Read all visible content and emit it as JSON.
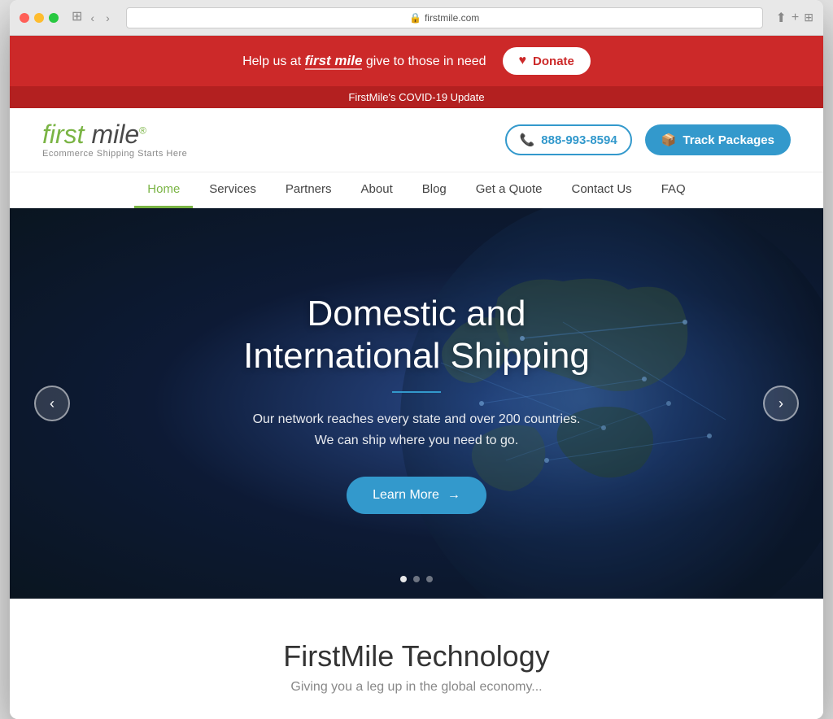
{
  "browser": {
    "url": "firstmile.com",
    "tab_label": "firstmile.com",
    "back_icon": "◀",
    "forward_icon": "▶"
  },
  "donation_banner": {
    "text_prefix": "Help us at ",
    "logo_text": "first mile",
    "text_suffix": " give to those in need",
    "donate_label": "Donate",
    "heart_icon": "♥"
  },
  "covid_banner": {
    "text": "FirstMile's COVID-19 Update"
  },
  "header": {
    "logo_first": "first",
    "logo_mile": " mile",
    "logo_tagline": "Ecommerce Shipping Starts Here",
    "phone": "888-993-8594",
    "phone_icon": "📞",
    "track_label": "Track Packages",
    "track_icon": "📦"
  },
  "nav": {
    "items": [
      {
        "label": "Home",
        "active": true
      },
      {
        "label": "Services",
        "active": false
      },
      {
        "label": "Partners",
        "active": false
      },
      {
        "label": "About",
        "active": false
      },
      {
        "label": "Blog",
        "active": false
      },
      {
        "label": "Get a Quote",
        "active": false
      },
      {
        "label": "Contact Us",
        "active": false
      },
      {
        "label": "FAQ",
        "active": false
      }
    ]
  },
  "hero": {
    "title": "Domestic and\nInternational Shipping",
    "divider": "",
    "subtitle_line1": "Our network reaches every state and over 200 countries.",
    "subtitle_line2": "We can ship where you need to go.",
    "cta_label": "Learn More",
    "cta_arrow": "→",
    "prev_arrow": "‹",
    "next_arrow": "›",
    "dots": [
      {
        "active": true
      },
      {
        "active": false
      },
      {
        "active": false
      }
    ]
  },
  "bottom": {
    "title": "FirstMile Technology",
    "subtitle": "Giving you a leg up in the global economy..."
  }
}
